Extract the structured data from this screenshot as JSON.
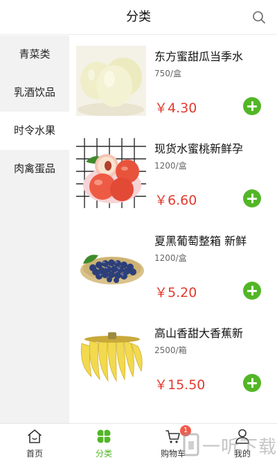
{
  "header": {
    "title": "分类",
    "search_icon": "search-icon"
  },
  "sidebar": {
    "items": [
      {
        "label": "青菜类",
        "active": false
      },
      {
        "label": "乳酒饮品",
        "active": false
      },
      {
        "label": "时令水果",
        "active": true
      },
      {
        "label": "肉禽蛋品",
        "active": false
      }
    ]
  },
  "products": [
    {
      "name": "东方蜜甜瓜当季水",
      "spec": "750/盒",
      "price": "￥4.30",
      "image": "melon-image"
    },
    {
      "name": "现货水蜜桃新鲜孕",
      "spec": "1200/盒",
      "price": "￥6.60",
      "image": "peach-image"
    },
    {
      "name": "夏黑葡萄整箱 新鲜",
      "spec": "1200/盒",
      "price": "￥5.20",
      "image": "grape-image"
    },
    {
      "name": "高山香甜大香蕉新",
      "spec": "2500/箱",
      "price": "￥15.50",
      "image": "banana-image"
    }
  ],
  "tabbar": {
    "tabs": [
      {
        "label": "首页",
        "icon": "home-icon"
      },
      {
        "label": "分类",
        "icon": "clover-icon",
        "active": true
      },
      {
        "label": "购物车",
        "icon": "cart-icon",
        "badge": "1"
      },
      {
        "label": "我的",
        "icon": "user-icon"
      }
    ]
  },
  "watermark": {
    "text": "一听下载"
  },
  "colors": {
    "accent": "#52b626",
    "price": "#e23a2e",
    "badge": "#f05a4a",
    "sidebar_bg": "#f2f2f2"
  }
}
